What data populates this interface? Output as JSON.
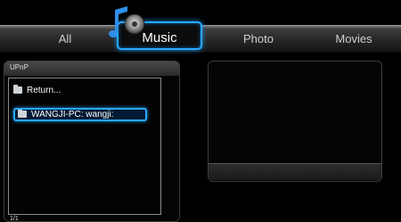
{
  "tabs": {
    "all": "All",
    "music": "Music",
    "photo": "Photo",
    "movies": "Movies"
  },
  "left_panel": {
    "title": "UPnP",
    "items": [
      {
        "label": "Return...",
        "icon": "folder-icon"
      },
      {
        "label": "WANGJI-PC: wangji:",
        "icon": "folder-icon",
        "selected": true
      }
    ],
    "page_indicator": "1/1"
  },
  "colors": {
    "accent": "#29a9ff",
    "background": "#000000"
  },
  "icons": {
    "music_tab": "music-note-icon"
  }
}
